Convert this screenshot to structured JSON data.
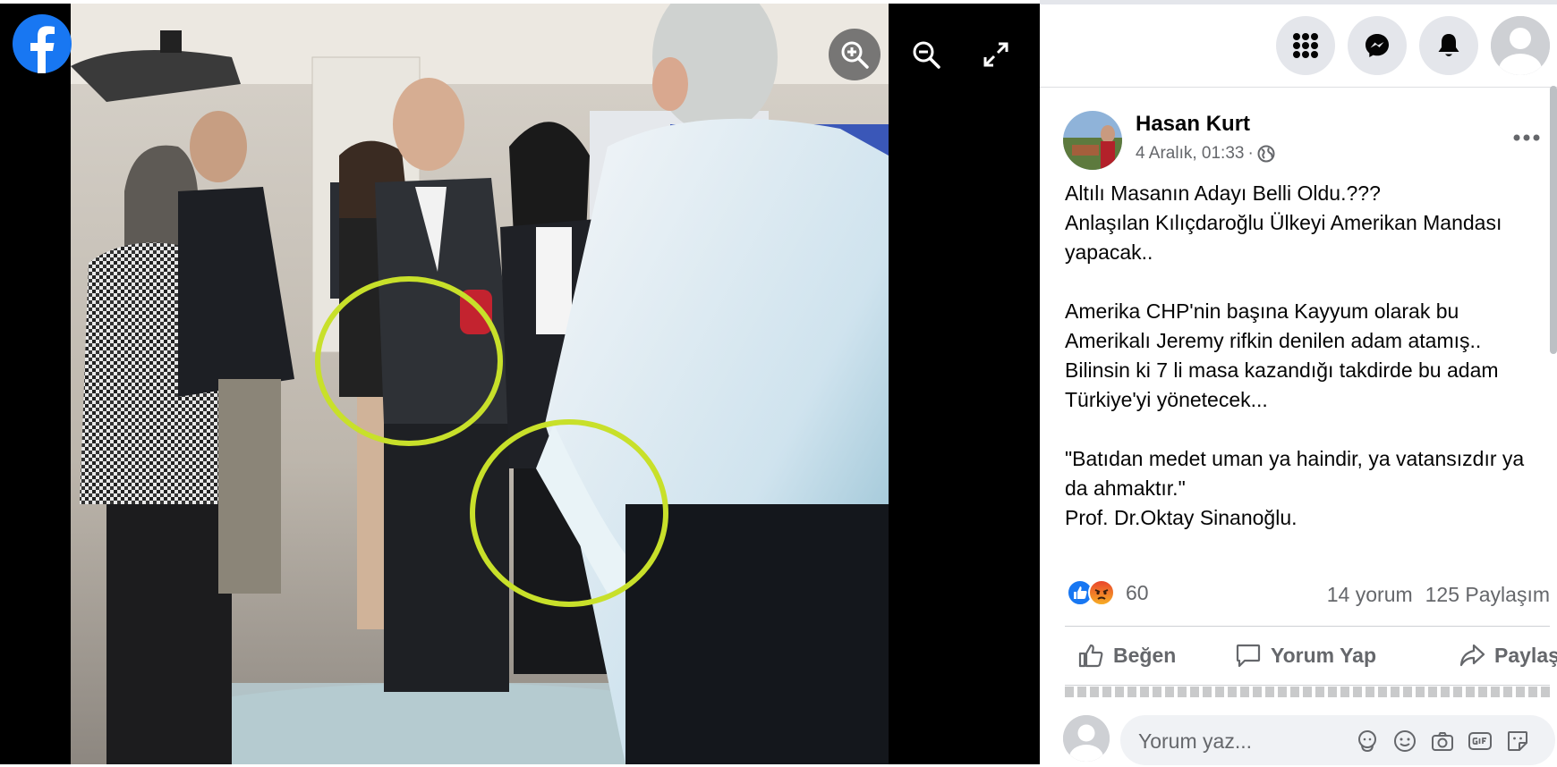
{
  "viewer": {
    "icons": {
      "logo": "facebook-logo",
      "zoom_in": "zoom-in-icon",
      "zoom_out": "zoom-out-icon",
      "fullscreen": "fullscreen-icon"
    }
  },
  "topbar": {
    "icons": [
      "menu-grid-icon",
      "messenger-icon",
      "bell-icon",
      "profile-avatar"
    ]
  },
  "post": {
    "author": "Hasan Kurt",
    "date": "4 Aralık, 01:33",
    "meta_sep": "·",
    "lines": [
      "Altılı Masanın Adayı Belli Oldu.???",
      "Anlaşılan Kılıçdaroğlu Ülkeyi Amerikan Mandası",
      "yapacak..",
      "",
      "Amerika CHP'nin başına Kayyum olarak bu",
      "Amerikalı Jeremy rifkin denilen adam atamış..",
      "Bilinsin ki 7 li masa kazandığı takdirde bu adam",
      "Türkiye'yi yönetecek...",
      "",
      "\"Batıdan medet uman ya haindir, ya vatansızdır ya",
      "da ahmaktır.\"",
      "Prof. Dr.Oktay Sinanoğlu."
    ],
    "reaction_count": "60",
    "comments": "14 yorum",
    "shares": "125 Paylaşım",
    "actions": {
      "like": "Beğen",
      "comment": "Yorum Yap",
      "share": "Paylaş"
    },
    "comment_placeholder": "Yorum yaz..."
  },
  "colors": {
    "fb_blue": "#1877f2",
    "text_secondary": "#65676b",
    "highlight_circle": "#c8e02a"
  }
}
